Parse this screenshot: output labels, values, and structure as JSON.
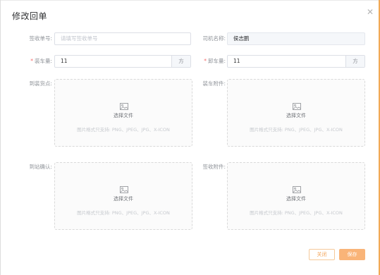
{
  "dialog": {
    "title": "修改回单"
  },
  "form": {
    "receipt_no_label": "签收单号:",
    "receipt_no_placeholder": "请填写签收单号",
    "driver_label": "司机名称:",
    "driver_value": "侯志鹏",
    "load_qty_label": "装车量:",
    "load_qty_value": "11",
    "load_qty_unit": "方",
    "unload_qty_label": "卸车量:",
    "unload_qty_value": "11",
    "unload_qty_unit": "方",
    "required_mark": "*"
  },
  "uploads": [
    {
      "label": "到装货点:",
      "pick": "选择文件",
      "hint": "图片格式只支持: PNG、JPEG、JPG、X-ICON",
      "icon": "image-icon"
    },
    {
      "label": "装车附件:",
      "pick": "选择文件",
      "hint": "图片格式只支持: PNG、JPEG、JPG、X-ICON",
      "icon": "image-icon"
    },
    {
      "label": "到站确认:",
      "pick": "选择文件",
      "hint": "图片格式只支持: PNG、JPEG、JPG、X-ICON",
      "icon": "image-icon"
    },
    {
      "label": "签收附件:",
      "pick": "选择文件",
      "hint": "图片格式只支持: PNG、JPEG、JPG、X-ICON",
      "icon": "image-icon"
    }
  ],
  "buttons": {
    "close": "关闭",
    "save": "保存"
  },
  "colors": {
    "accent": "#f9b478",
    "required": "#f56c6c",
    "border": "#dcdfe6"
  }
}
